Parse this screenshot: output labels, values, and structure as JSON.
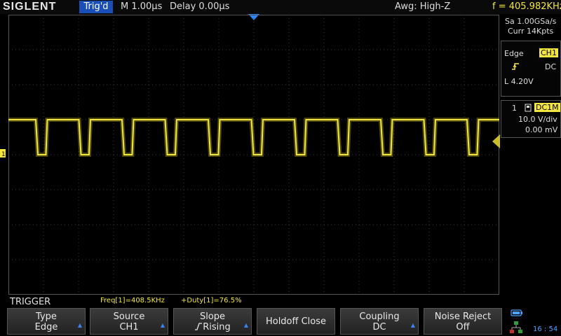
{
  "topbar": {
    "brand": "SIGLENT",
    "trigger_state": "Trig'd",
    "timebase": "M 1.00μs",
    "delay": "Delay 0.00μs",
    "awg": "Awg: High-Z",
    "frequency": "f = 405.982KHz"
  },
  "acquisition": {
    "sample_rate": "Sa 1.00GSa/s",
    "memory": "Curr 14Kpts"
  },
  "trigger_panel": {
    "type": "Edge",
    "source": "CH1",
    "slope_icon": "rising-edge-icon",
    "coupling": "DC",
    "level": "L  4.20V"
  },
  "channel_panel": {
    "number": "1",
    "coupling": "DC1M",
    "scale": "10.0 V/div",
    "offset": "0.00 mV"
  },
  "menu": {
    "title": "TRIGGER",
    "measurement_freq": "Freq[1]=408.5KHz",
    "measurement_duty": "+Duty[1]=76.5%"
  },
  "softkeys": [
    {
      "line1": "Type",
      "line2": "Edge",
      "has_arrow": true
    },
    {
      "line1": "Source",
      "line2": "CH1",
      "has_arrow": true
    },
    {
      "line1": "Slope",
      "line2": "Rising",
      "has_arrow": true
    },
    {
      "line1": "Holdoff Close",
      "line2": "",
      "has_arrow": false
    },
    {
      "line1": "Coupling",
      "line2": "DC",
      "has_arrow": true
    },
    {
      "line1": "Noise Reject",
      "line2": "Off",
      "has_arrow": false
    }
  ],
  "status": {
    "clock": "16 : 54"
  },
  "colors": {
    "trace": "#f3e640",
    "accent": "#1b4fb8",
    "grid": "#3a3a3a"
  },
  "waveform": {
    "channel": "CH1",
    "high_level_div": 1.0,
    "low_level_div": 0.0,
    "period_us": 1.23,
    "first_fall_us": 0.78,
    "duty_percent": 76.5
  }
}
